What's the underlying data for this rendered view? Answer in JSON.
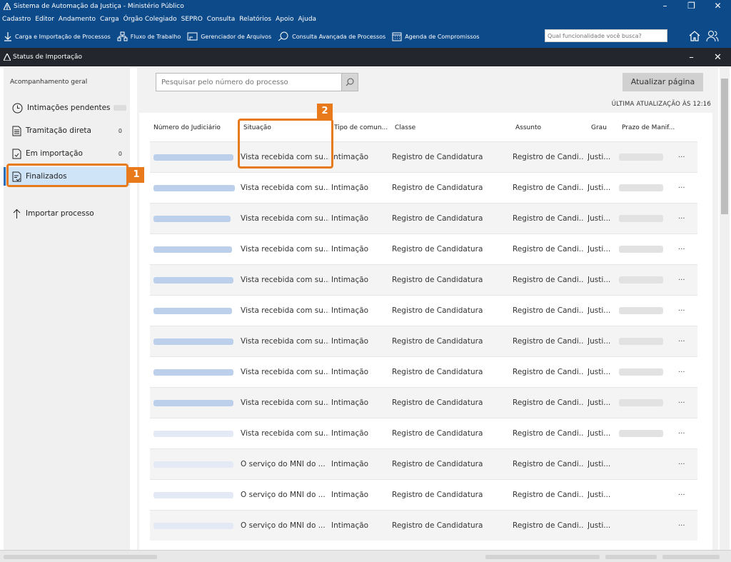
{
  "window": {
    "title": "Sistema de Automação da Justiça - Ministério Público"
  },
  "menu": [
    "Cadastro",
    "Editor",
    "Andamento",
    "Carga",
    "Órgão Colegiado",
    "SEPRO",
    "Consulta",
    "Relatórios",
    "Apoio",
    "Ajuda"
  ],
  "toolbar": {
    "items": [
      {
        "label": "Carga e Importação de Processos",
        "icon": "download-icon"
      },
      {
        "label": "Fluxo de Trabalho",
        "icon": "workflow-icon"
      },
      {
        "label": "Gerenciador de Arquivos",
        "icon": "file-manager-icon"
      },
      {
        "label": "Consulta Avançada de Processos",
        "icon": "search-icon"
      },
      {
        "label": "Agenda de Compromissos",
        "icon": "calendar-icon"
      }
    ],
    "search_placeholder": "Qual funcionalidade você busca?"
  },
  "subwindow": {
    "title": "Status de Importação"
  },
  "sidebar": {
    "heading": "Acompanhamento geral",
    "items": [
      {
        "label": "Intimações pendentes",
        "count": "",
        "icon": "clock-icon"
      },
      {
        "label": "Tramitação direta",
        "count": "0",
        "icon": "document-icon"
      },
      {
        "label": "Em importação",
        "count": "0",
        "icon": "document-import-icon"
      },
      {
        "label": "Finalizados",
        "count": "",
        "icon": "document-check-icon"
      }
    ],
    "import_label": "Importar processo"
  },
  "main": {
    "search_placeholder": "Pesquisar pelo número do processo",
    "refresh_label": "Atualizar página",
    "last_update": "ÚLTIMA ATUALIZAÇÃO ÀS 12:16"
  },
  "table": {
    "headers": [
      "Número do Judiciário",
      "Situação",
      "Tipo de comun...",
      "Classe",
      "Assunto",
      "Grau",
      "Prazo de Manif..."
    ],
    "rows": [
      {
        "situacao": "Vista recebida com su...",
        "tipo": "Intimação",
        "classe": "Registro de Candidatura",
        "assunto": "Registro de Candi...",
        "grau": "Justi...",
        "prazo_shown": true
      },
      {
        "situacao": "Vista recebida com su...",
        "tipo": "Intimação",
        "classe": "Registro de Candidatura",
        "assunto": "Registro de Candi...",
        "grau": "Justi...",
        "prazo_shown": true
      },
      {
        "situacao": "Vista recebida com su...",
        "tipo": "Intimação",
        "classe": "Registro de Candidatura",
        "assunto": "Registro de Candi...",
        "grau": "Justi...",
        "prazo_shown": true
      },
      {
        "situacao": "Vista recebida com su...",
        "tipo": "Intimação",
        "classe": "Registro de Candidatura",
        "assunto": "Registro de Candi...",
        "grau": "Justi...",
        "prazo_shown": true
      },
      {
        "situacao": "Vista recebida com su...",
        "tipo": "Intimação",
        "classe": "Registro de Candidatura",
        "assunto": "Registro de Candi...",
        "grau": "Justi...",
        "prazo_shown": true
      },
      {
        "situacao": "Vista recebida com su...",
        "tipo": "Intimação",
        "classe": "Registro de Candidatura",
        "assunto": "Registro de Candi...",
        "grau": "Justi...",
        "prazo_shown": true
      },
      {
        "situacao": "Vista recebida com su...",
        "tipo": "Intimação",
        "classe": "Registro de Candidatura",
        "assunto": "Registro de Candi...",
        "grau": "Justi...",
        "prazo_shown": true
      },
      {
        "situacao": "Vista recebida com su...",
        "tipo": "Intimação",
        "classe": "Registro de Candidatura",
        "assunto": "Registro de Candi...",
        "grau": "Justi...",
        "prazo_shown": true
      },
      {
        "situacao": "Vista recebida com su...",
        "tipo": "Intimação",
        "classe": "Registro de Candidatura",
        "assunto": "Registro de Candi...",
        "grau": "Justi...",
        "prazo_shown": true
      },
      {
        "situacao": "Vista recebida com su...",
        "tipo": "Intimação",
        "classe": "Registro de Candidatura",
        "assunto": "Registro de Candi...",
        "grau": "Justi...",
        "prazo_shown": true
      },
      {
        "situacao": "O serviço do MNI do ...",
        "tipo": "Intimação",
        "classe": "Registro de Candidatura",
        "assunto": "Registro de Candi...",
        "grau": "Justi...",
        "prazo_shown": false
      },
      {
        "situacao": "O serviço do MNI do ...",
        "tipo": "Intimação",
        "classe": "Registro de Candidatura",
        "assunto": "Registro de Candi...",
        "grau": "Justi...",
        "prazo_shown": false
      },
      {
        "situacao": "O serviço do MNI do ...",
        "tipo": "Intimação",
        "classe": "Registro de Candidatura",
        "assunto": "Registro de Candi...",
        "grau": "Justi...",
        "prazo_shown": false
      }
    ],
    "row_action": "···"
  },
  "callouts": [
    "1",
    "2"
  ]
}
